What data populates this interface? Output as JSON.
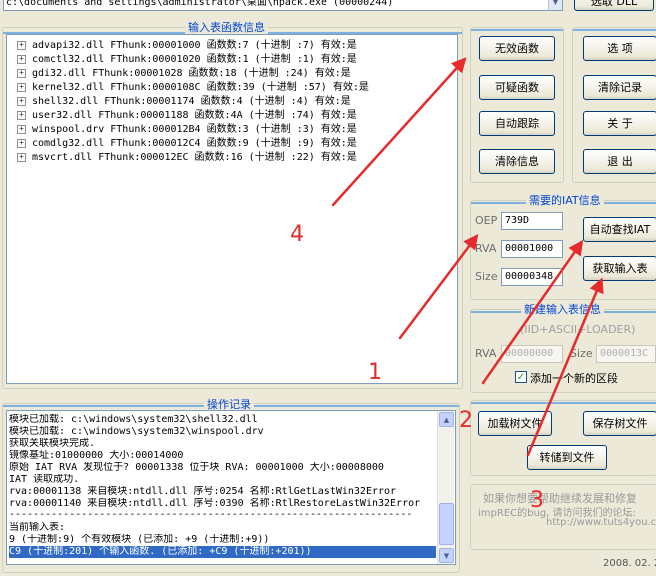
{
  "process": {
    "path": "c:\\documents and settings\\administrator\\桌面\\npack.exe (00000244)",
    "top_button": "选取 DLL"
  },
  "import_tree": {
    "title": "输入表函数信息",
    "items": [
      "advapi32.dll FThunk:00001000 函数数:7 (十进制 :7) 有效:是",
      "comctl32.dll FThunk:00001020 函数数:1 (十进制 :1) 有效:是",
      "gdi32.dll FThunk:00001028 函数数:18 (十进制 :24) 有效:是",
      "kernel32.dll FThunk:0000108C 函数数:39 (十进制 :57) 有效:是",
      "shell32.dll FThunk:00001174 函数数:4 (十进制 :4) 有效:是",
      "user32.dll FThunk:00001188 函数数:4A (十进制 :74) 有效:是",
      "winspool.drv FThunk:000012B4 函数数:3 (十进制 :3) 有效:是",
      "comdlg32.dll FThunk:000012C4 函数数:9 (十进制 :9) 有效:是",
      "msvcrt.dll FThunk:000012EC 函数数:16 (十进制 :22) 有效:是"
    ]
  },
  "func_buttons": [
    "无效函数",
    "可疑函数",
    "自动跟踪",
    "清除信息"
  ],
  "side_buttons": [
    "选    项",
    "清除记录",
    "关    于",
    "退    出"
  ],
  "iat_group": {
    "title": "需要的IAT信息",
    "oep_label": "OEP",
    "oep_value": "739D",
    "rva_label": "RVA",
    "rva_value": "00001000",
    "size_label": "Size",
    "size_value": "00000348",
    "auto_button": "自动查找IAT",
    "get_button": "获取输入表"
  },
  "new_import_group": {
    "title": "新建输入表信息",
    "hint": "(IID+ASCII+LOADER)",
    "rva_label": "RVA",
    "rva_value": "00000000",
    "size_label": "Size",
    "size_value": "0000013C",
    "checkbox_label": "添加一个新的区段",
    "checkbox_checked": true
  },
  "tree_buttons": {
    "load": "加载树文件",
    "save": "保存树文件",
    "dump": "转储到文件"
  },
  "log": {
    "title": "操作记录",
    "lines": [
      "模块已加载: c:\\windows\\system32\\shell32.dll",
      "模块已加载: c:\\windows\\system32\\winspool.drv",
      "获取关联模块完成.",
      "镜像基址:01000000 大小:00014000",
      "原始 IAT RVA 发现位于? 00001338 位于块 RVA: 00001000 大小:00008000",
      "IAT 读取成功.",
      "rva:00001138 来自模块:ntdll.dll 序号:0254 名称:RtlGetLastWin32Error",
      "rva:00001140 来自模块:ntdll.dll 序号:0390 名称:RtlRestoreLastWin32Error",
      "-------------------------------------------------------------------",
      "当前输入表:",
      "9 (十进制:9) 个有效模块 (已添加: +9 (十进制:+9))",
      "C9 (十进制:201) 个输入函数. (已添加: +C9 (十进制:+201))"
    ]
  },
  "info": {
    "text1": "如果你想要帮助继续发展和修复",
    "text2": "impREC的bug, 请访问我们的论坛:",
    "url": "http://www.tuts4you.com",
    "date": "2008. 02. 2"
  },
  "annotations": [
    "4",
    "1",
    "2",
    "3"
  ],
  "colors": {
    "annotation": "#e52b2b",
    "selection": "#316ac5",
    "group_title": "#0046d5"
  }
}
